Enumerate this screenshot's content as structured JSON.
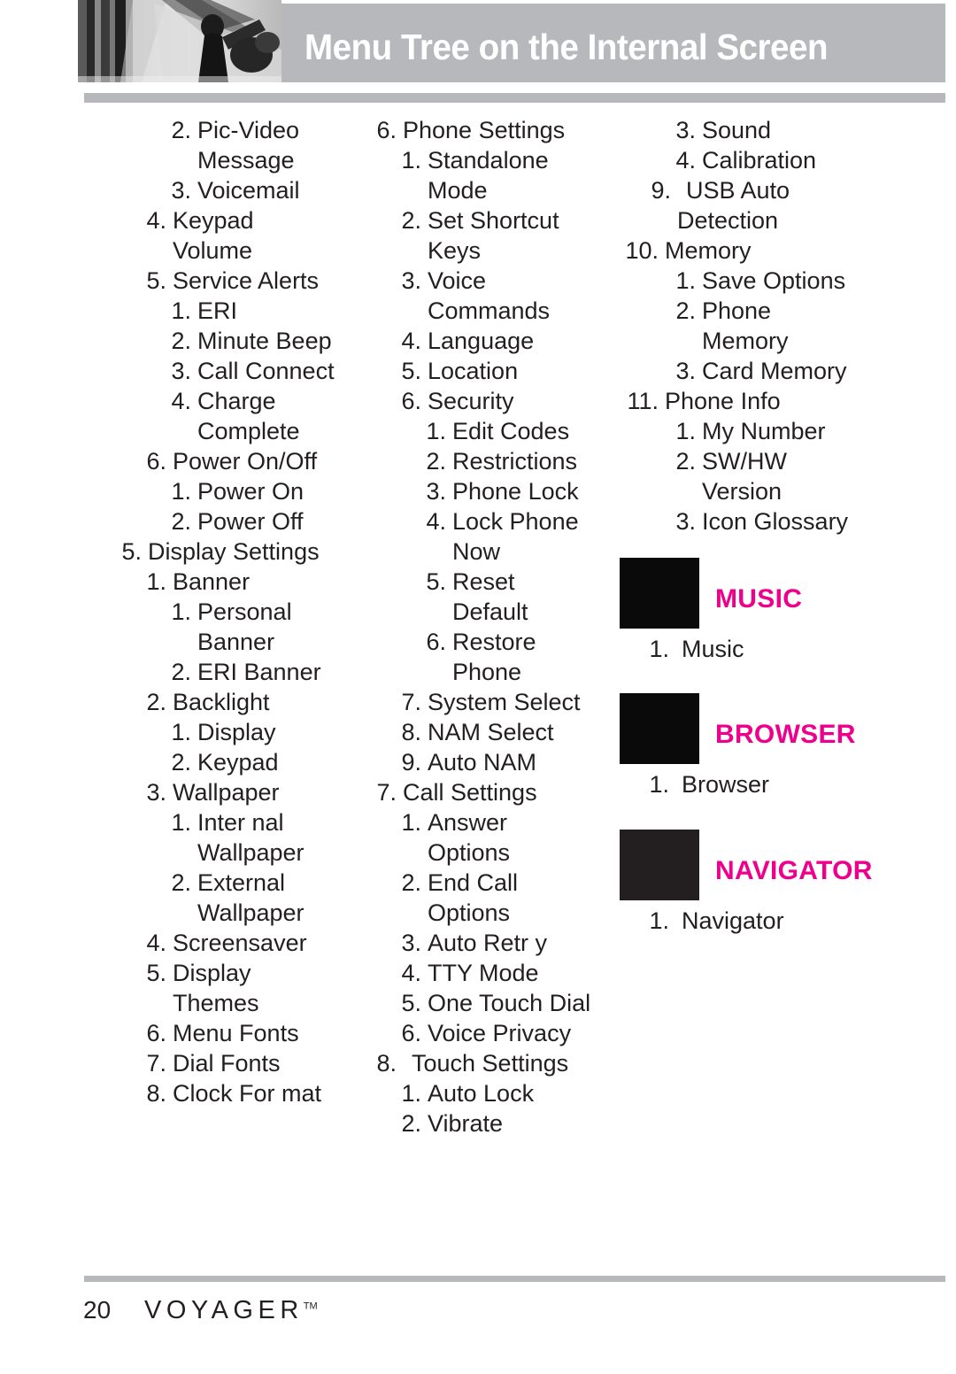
{
  "header": {
    "title": "Menu Tree on the Internal Screen",
    "photo_alt": "grayscale-photo"
  },
  "columns": [
    {
      "name": "column-1",
      "lines": [
        {
          "num": "2.",
          "text": "Pic-Video",
          "level": 2
        },
        {
          "num": "",
          "text": "Message",
          "level": "cont2"
        },
        {
          "num": "3.",
          "text": "Voicemail",
          "level": 2
        },
        {
          "num": "4.",
          "text": "Keypad",
          "level": 1
        },
        {
          "num": "",
          "text": "Volume",
          "level": "cont1"
        },
        {
          "num": "5.",
          "text": "Service Alerts",
          "level": 1
        },
        {
          "num": "1.",
          "text": "ERI",
          "level": 2
        },
        {
          "num": "2.",
          "text": "Minute Beep",
          "level": 2
        },
        {
          "num": "3.",
          "text": "Call Connect",
          "level": 2
        },
        {
          "num": "4.",
          "text": "Charge",
          "level": 2
        },
        {
          "num": "",
          "text": "Complete",
          "level": "cont2"
        },
        {
          "num": "6.",
          "text": "Power On/Off",
          "level": 1
        },
        {
          "num": "1.",
          "text": "Power On",
          "level": 2
        },
        {
          "num": "2.",
          "text": "Power Off",
          "level": 2
        },
        {
          "num": "5.",
          "text": "Display Settings",
          "level": 0
        },
        {
          "num": "1.",
          "text": "Banner",
          "level": 1
        },
        {
          "num": "1.",
          "text": "Personal",
          "level": 2
        },
        {
          "num": "",
          "text": "Banner",
          "level": "cont2"
        },
        {
          "num": "2.",
          "text": "ERI Banner",
          "level": 2
        },
        {
          "num": "2.",
          "text": "Backlight",
          "level": 1
        },
        {
          "num": "1.",
          "text": "Display",
          "level": 2
        },
        {
          "num": "2.",
          "text": "Keypad",
          "level": 2
        },
        {
          "num": "3.",
          "text": "Wallpaper",
          "level": 1
        },
        {
          "num": "1.",
          "text": "Inter nal",
          "level": 2
        },
        {
          "num": "",
          "text": "Wallpaper",
          "level": "cont2"
        },
        {
          "num": "2.",
          "text": "External",
          "level": 2
        },
        {
          "num": "",
          "text": "Wallpaper",
          "level": "cont2"
        },
        {
          "num": "4.",
          "text": "Screensaver",
          "level": 1
        },
        {
          "num": "5.",
          "text": "Display",
          "level": 1
        },
        {
          "num": "",
          "text": "Themes",
          "level": "cont1"
        },
        {
          "num": "6.",
          "text": "Menu Fonts",
          "level": 1
        },
        {
          "num": "7.",
          "text": "Dial Fonts",
          "level": 1
        },
        {
          "num": "8.",
          "text": "Clock For mat",
          "level": 1
        }
      ]
    },
    {
      "name": "column-2",
      "lines": [
        {
          "num": "6.",
          "text": "Phone Settings",
          "level": 0
        },
        {
          "num": "1.",
          "text": "Standalone",
          "level": 1
        },
        {
          "num": "",
          "text": "Mode",
          "level": "cont1"
        },
        {
          "num": "2.",
          "text": "Set Shortcut",
          "level": 1
        },
        {
          "num": "",
          "text": "Keys",
          "level": "cont1"
        },
        {
          "num": "3.",
          "text": "Voice",
          "level": 1
        },
        {
          "num": "",
          "text": "Commands",
          "level": "cont1"
        },
        {
          "num": "4.",
          "text": "Language",
          "level": 1
        },
        {
          "num": "5.",
          "text": "Location",
          "level": 1
        },
        {
          "num": "6.",
          "text": "Security",
          "level": 1
        },
        {
          "num": "1.",
          "text": "Edit Codes",
          "level": 2
        },
        {
          "num": "2.",
          "text": "Restrictions",
          "level": 2
        },
        {
          "num": "3.",
          "text": "Phone Lock",
          "level": 2
        },
        {
          "num": "4.",
          "text": "Lock Phone",
          "level": 2
        },
        {
          "num": "",
          "text": "Now",
          "level": "cont2"
        },
        {
          "num": "5.",
          "text": "Reset",
          "level": 2
        },
        {
          "num": "",
          "text": "Default",
          "level": "cont2"
        },
        {
          "num": "6.",
          "text": "Restore",
          "level": 2
        },
        {
          "num": "",
          "text": "Phone",
          "level": "cont2"
        },
        {
          "num": "7.",
          "text": "System Select",
          "level": 1
        },
        {
          "num": "8.",
          "text": "NAM Select",
          "level": 1
        },
        {
          "num": "9.",
          "text": "Auto NAM",
          "level": 1
        },
        {
          "num": "7.",
          "text": "Call Settings",
          "level": 0
        },
        {
          "num": "1.",
          "text": "Answer",
          "level": 1
        },
        {
          "num": "",
          "text": "Options",
          "level": "cont1"
        },
        {
          "num": "2.",
          "text": "End Call",
          "level": 1
        },
        {
          "num": "",
          "text": "Options",
          "level": "cont1"
        },
        {
          "num": "3.",
          "text": "Auto Retr y",
          "level": 1
        },
        {
          "num": "4.",
          "text": "TTY Mode",
          "level": 1
        },
        {
          "num": "5.",
          "text": "One Touch Dial",
          "level": 1
        },
        {
          "num": "6.",
          "text": "Voice Privacy",
          "level": 1
        },
        {
          "num": "8.",
          "text": "Touch Settings",
          "level": "0gap"
        },
        {
          "num": "1.",
          "text": "Auto Lock",
          "level": 1
        },
        {
          "num": "2.",
          "text": "Vibrate",
          "level": 1
        }
      ]
    },
    {
      "name": "column-3",
      "lines": [
        {
          "num": "3.",
          "text": "Sound",
          "level": 2
        },
        {
          "num": "4.",
          "text": "Calibration",
          "level": 2
        },
        {
          "num": "9.",
          "text": "USB Auto",
          "level": "1gap"
        },
        {
          "num": "",
          "text": "Detection",
          "level": "cont1"
        },
        {
          "num": "10.",
          "text": "Memory",
          "level": "wide"
        },
        {
          "num": "1.",
          "text": "Save Options",
          "level": 2
        },
        {
          "num": "2.",
          "text": "Phone",
          "level": 2
        },
        {
          "num": "",
          "text": "Memory",
          "level": "cont2"
        },
        {
          "num": "3.",
          "text": "Card Memory",
          "level": 2
        },
        {
          "num": "11.",
          "text": "Phone Info",
          "level": "wide"
        },
        {
          "num": "1.",
          "text": "My Number",
          "level": 2
        },
        {
          "num": "2.",
          "text": "SW/HW",
          "level": 2
        },
        {
          "num": "",
          "text": "Version",
          "level": "cont2"
        },
        {
          "num": "3.",
          "text": "Icon Glossary",
          "level": 2
        }
      ]
    }
  ],
  "sections": [
    {
      "name": "music",
      "title": "MUSIC",
      "item_num": "1.",
      "item_text": "Music"
    },
    {
      "name": "browser",
      "title": "BROWSER",
      "item_num": "1.",
      "item_text": "Browser"
    },
    {
      "name": "navigator",
      "title": "NAVIGATOR",
      "item_num": "1.",
      "item_text": "Navigator"
    }
  ],
  "footer": {
    "page_number": "20",
    "logo": "VOYAGER",
    "logo_tm": "TM"
  },
  "colors": {
    "accent_magenta": "#ec008c",
    "header_gray": "#b6b8bc",
    "text": "#231f20"
  }
}
